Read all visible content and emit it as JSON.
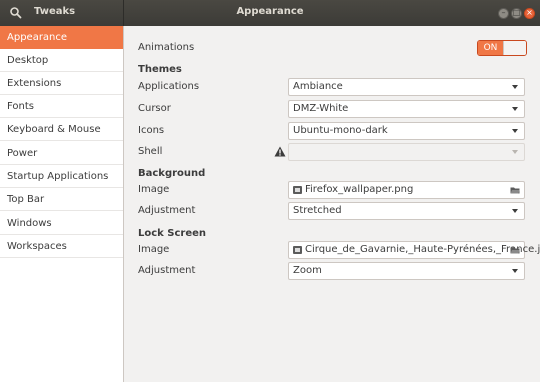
{
  "header": {
    "app_title": "Tweaks",
    "page_title": "Appearance",
    "search_icon": "search-icon",
    "window_buttons": [
      "minimize-icon",
      "maximize-icon",
      "close-icon"
    ]
  },
  "sidebar": {
    "items": [
      {
        "label": "Appearance",
        "active": true
      },
      {
        "label": "Desktop"
      },
      {
        "label": "Extensions"
      },
      {
        "label": "Fonts"
      },
      {
        "label": "Keyboard & Mouse"
      },
      {
        "label": "Power"
      },
      {
        "label": "Startup Applications"
      },
      {
        "label": "Top Bar"
      },
      {
        "label": "Windows"
      },
      {
        "label": "Workspaces"
      }
    ]
  },
  "main": {
    "animations": {
      "label": "Animations",
      "toggle_text": "ON",
      "value": true
    },
    "themes": {
      "heading": "Themes",
      "applications": {
        "label": "Applications",
        "value": "Ambiance"
      },
      "cursor": {
        "label": "Cursor",
        "value": "DMZ-White"
      },
      "icons": {
        "label": "Icons",
        "value": "Ubuntu-mono-dark"
      },
      "shell": {
        "label": "Shell",
        "value": "",
        "warning_icon": "warning-icon",
        "disabled": true
      }
    },
    "background": {
      "heading": "Background",
      "image": {
        "label": "Image",
        "value": "Firefox_wallpaper.png"
      },
      "adjustment": {
        "label": "Adjustment",
        "value": "Stretched"
      }
    },
    "lock_screen": {
      "heading": "Lock Screen",
      "image": {
        "label": "Image",
        "value": "Cirque_de_Gavarnie,_Haute-Pyrénées,_France.jpg"
      },
      "adjustment": {
        "label": "Adjustment",
        "value": "Zoom"
      }
    }
  },
  "colors": {
    "accent": "#f07746",
    "headerbar": "#3c3b37",
    "background": "#f2f1f0"
  }
}
